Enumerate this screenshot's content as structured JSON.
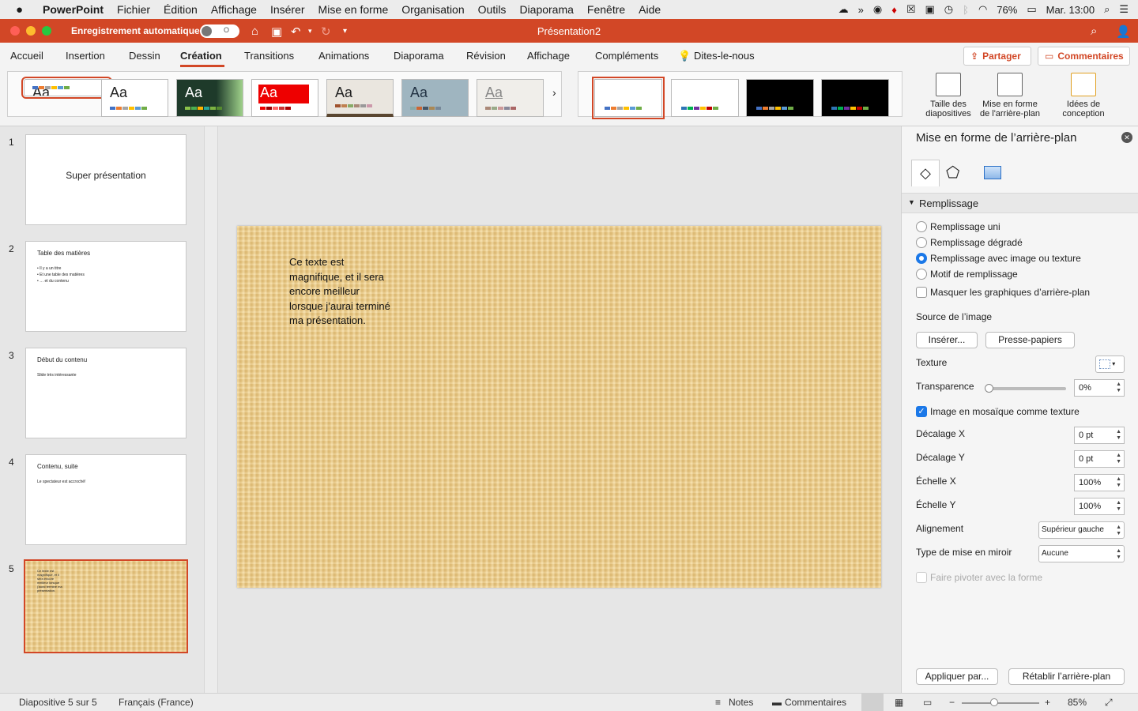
{
  "menubar": {
    "app": "PowerPoint",
    "items": [
      "Fichier",
      "Édition",
      "Affichage",
      "Insérer",
      "Mise en forme",
      "Organisation",
      "Outils",
      "Diaporama",
      "Fenêtre",
      "Aide"
    ],
    "battery": "76%",
    "clock": "Mar. 13:00"
  },
  "titlebar": {
    "autosave_label": "Enregistrement automatique",
    "autosave_state": "O",
    "doc_title": "Présentation2"
  },
  "tabs": {
    "items": [
      "Accueil",
      "Insertion",
      "Dessin",
      "Création",
      "Transitions",
      "Animations",
      "Diaporama",
      "Révision",
      "Affichage",
      "Compléments"
    ],
    "active": "Création",
    "tell_me": "Dites-le-nous",
    "share": "Partager",
    "comments": "Commentaires"
  },
  "ribbon": {
    "theme_label": "Aa",
    "more": "›",
    "slide_size": "Taille des diapositives",
    "format_bg": "Mise en forme de l'arrière-plan",
    "design_ideas": "Idées de conception"
  },
  "slides": [
    {
      "num": "1",
      "title": "Super présentation"
    },
    {
      "num": "2",
      "title": "Table des matières",
      "bullets": [
        "• Il y a un titre",
        "• Et une table des matières",
        "• … et du contenu"
      ]
    },
    {
      "num": "3",
      "title": "Début du contenu",
      "body": "Slide très intéressante"
    },
    {
      "num": "4",
      "title": "Contenu, suite",
      "body": "Le spectateur est accroché!"
    },
    {
      "num": "5",
      "body": "Ce texte est magnifique, et il sera encore meilleur lorsque j'aurai terminé ma présentation."
    }
  ],
  "slide": {
    "text": "Ce texte est magnifique, et il sera encore meilleur lorsque j’aurai terminé ma présentation."
  },
  "pane": {
    "title": "Mise en forme de l’arrière-plan",
    "section": "Remplissage",
    "fill_options": [
      "Remplissage uni",
      "Remplissage dégradé",
      "Remplissage avec image ou texture",
      "Motif de remplissage"
    ],
    "fill_selected": "Remplissage avec image ou texture",
    "hide_graphics": "Masquer les graphiques d’arrière-plan",
    "image_source": "Source de l’image",
    "insert_btn": "Insérer...",
    "clipboard_btn": "Presse-papiers",
    "texture": "Texture",
    "transparency": "Transparence",
    "transparency_value": "0%",
    "tile": "Image en mosaïque comme texture",
    "tile_checked": true,
    "offset_x": "Décalage X",
    "offset_x_value": "0 pt",
    "offset_y": "Décalage Y",
    "offset_y_value": "0 pt",
    "scale_x": "Échelle X",
    "scale_x_value": "100%",
    "scale_y": "Échelle Y",
    "scale_y_value": "100%",
    "alignment": "Alignement",
    "alignment_value": "Supérieur gauche",
    "mirror": "Type de mise en miroir",
    "mirror_value": "Aucune",
    "rotate": "Faire pivoter avec la forme",
    "apply_btn": "Appliquer par...",
    "reset_btn": "Rétablir l’arrière-plan"
  },
  "status": {
    "slide_of": "Diapositive 5 sur 5",
    "language": "Français (France)",
    "notes": "Notes",
    "comments": "Commentaires",
    "zoom": "85%"
  },
  "colors": {
    "accent": "#d24726",
    "selection": "#1b78e8"
  }
}
